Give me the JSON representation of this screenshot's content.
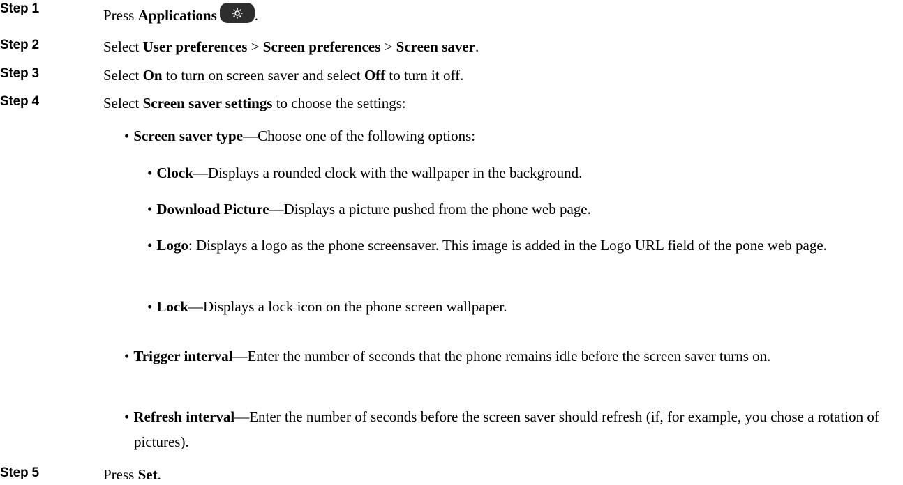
{
  "steps": [
    {
      "label": "Step 1",
      "pre": "Press ",
      "bold": "Applications",
      "post": "."
    },
    {
      "label": "Step 2",
      "pre": "Select ",
      "b1": "User preferences",
      "sep1": " > ",
      "b2": "Screen preferences",
      "sep2": " > ",
      "b3": "Screen saver",
      "post": "."
    },
    {
      "label": "Step 3",
      "pre": "Select ",
      "b1": "On",
      "mid": " to turn on screen saver and select ",
      "b2": "Off",
      "post": " to turn it off."
    },
    {
      "label": "Step 4",
      "pre": "Select ",
      "bold": "Screen saver settings",
      "post": " to choose the settings:"
    },
    {
      "label": "Step 5",
      "pre": "Press ",
      "bold": "Set",
      "post": "."
    }
  ],
  "settings": {
    "type": {
      "bold": "Screen saver type",
      "text": "—Choose one of the following options:"
    },
    "options": [
      {
        "bold": "Clock",
        "text": "—Displays a rounded clock with the wallpaper in the background."
      },
      {
        "bold": "Download Picture",
        "text": "—Displays a picture pushed from the phone web page."
      },
      {
        "bold": "Logo",
        "text": ": Displays a logo as the phone screensaver. This image is added in the Logo URL field of the pone web page."
      },
      {
        "bold": "Lock",
        "text": "—Displays a lock icon on the phone screen wallpaper."
      }
    ],
    "trigger": {
      "bold": "Trigger interval",
      "text": "—Enter the number of seconds that the phone remains idle before the screen saver turns on."
    },
    "refresh": {
      "bold": "Refresh interval",
      "text": "—Enter the number of seconds before the screen saver should refresh (if, for example, you chose a rotation of pictures)."
    }
  },
  "icons": {
    "applications": "gear-icon"
  },
  "colors": {
    "icon_bg": "#2e2e2e",
    "icon_fg": "#ffffff"
  }
}
